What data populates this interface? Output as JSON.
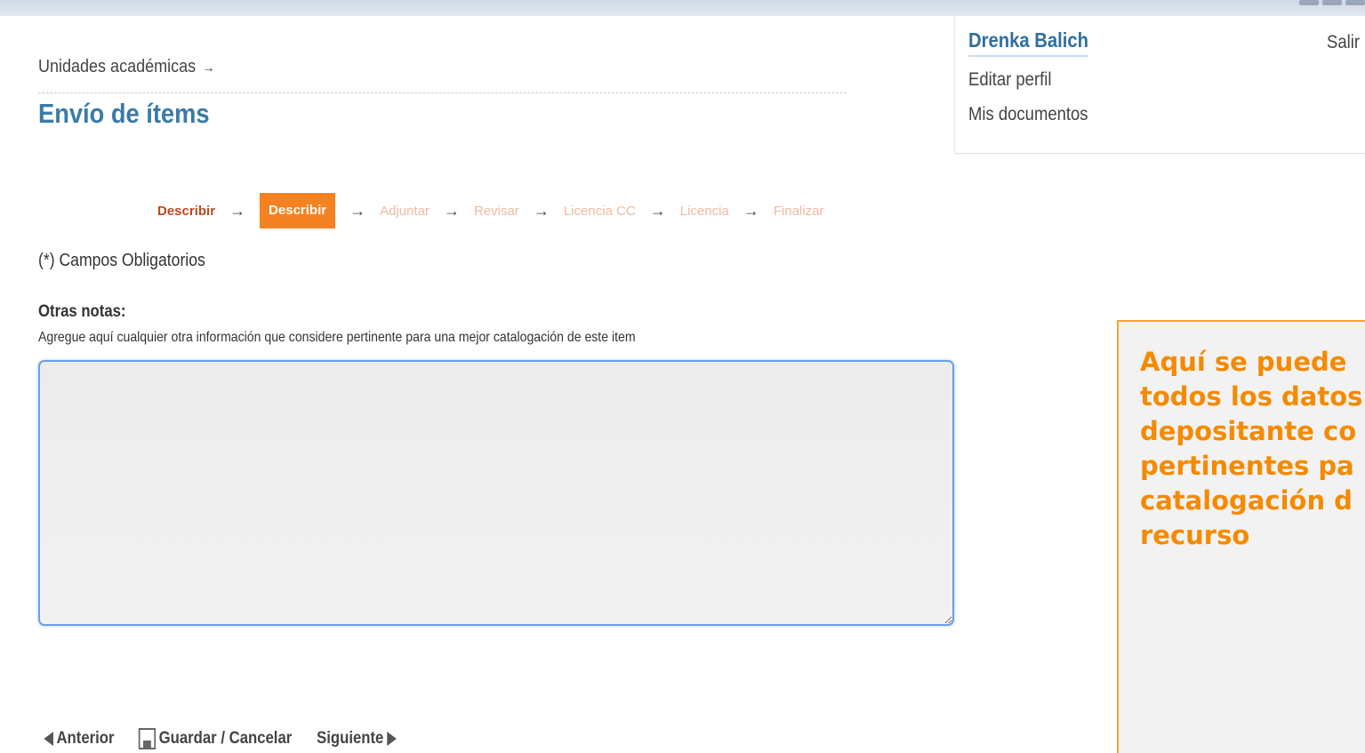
{
  "user_panel": {
    "name": "Drenka Balich",
    "logout": "Salir",
    "links": [
      "Editar perfil",
      "Mis documentos"
    ]
  },
  "breadcrumb": {
    "label": "Unidades académicas",
    "arrow": "→"
  },
  "page_title": "Envío de ítems",
  "steps": [
    {
      "label": "Describir",
      "state": "done"
    },
    {
      "label": "Describir",
      "state": "active"
    },
    {
      "label": "Adjuntar",
      "state": "pending"
    },
    {
      "label": "Revisar",
      "state": "pending"
    },
    {
      "label": "Licencia CC",
      "state": "pending"
    },
    {
      "label": "Licencia",
      "state": "pending"
    },
    {
      "label": "Finalizar",
      "state": "pending"
    }
  ],
  "step_arrow": "→",
  "required_note": "(*) Campos Obligatorios",
  "field": {
    "label": "Otras notas:",
    "help": "Agregue aquí cualquier otra información que considere pertinente para una mejor catalogación de este item",
    "value": ""
  },
  "nav": {
    "previous": "Anterior",
    "save_cancel": "Guardar / Cancelar",
    "next": "Siguiente"
  },
  "callout": {
    "lines": [
      "Aquí se puede",
      "todos los datos",
      "depositante co",
      "pertinentes pa",
      "catalogación d",
      "recurso"
    ]
  },
  "colors": {
    "accent_orange": "#f58220",
    "title_blue": "#3a7ba8",
    "callout_text": "#f58a00"
  }
}
